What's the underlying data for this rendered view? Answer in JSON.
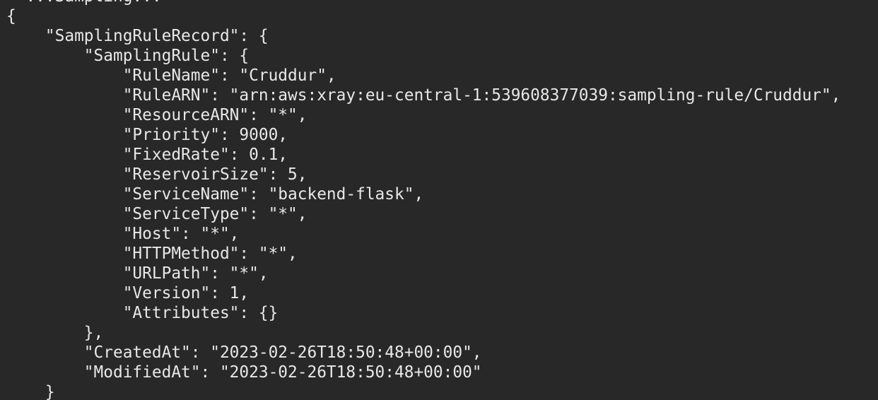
{
  "terminal": {
    "background": "#282828",
    "foreground": "#e8e8e8",
    "lines": [
      "  ...Sampling...",
      "{",
      "    \"SamplingRuleRecord\": {",
      "        \"SamplingRule\": {",
      "            \"RuleName\": \"Cruddur\",",
      "            \"RuleARN\": \"arn:aws:xray:eu-central-1:539608377039:sampling-rule/Cruddur\",",
      "            \"ResourceARN\": \"*\",",
      "            \"Priority\": 9000,",
      "            \"FixedRate\": 0.1,",
      "            \"ReservoirSize\": 5,",
      "            \"ServiceName\": \"backend-flask\",",
      "            \"ServiceType\": \"*\",",
      "            \"Host\": \"*\",",
      "            \"HTTPMethod\": \"*\",",
      "            \"URLPath\": \"*\",",
      "            \"Version\": 1,",
      "            \"Attributes\": {}",
      "        },",
      "        \"CreatedAt\": \"2023-02-26T18:50:48+00:00\",",
      "        \"ModifiedAt\": \"2023-02-26T18:50:48+00:00\"",
      "    }"
    ]
  }
}
